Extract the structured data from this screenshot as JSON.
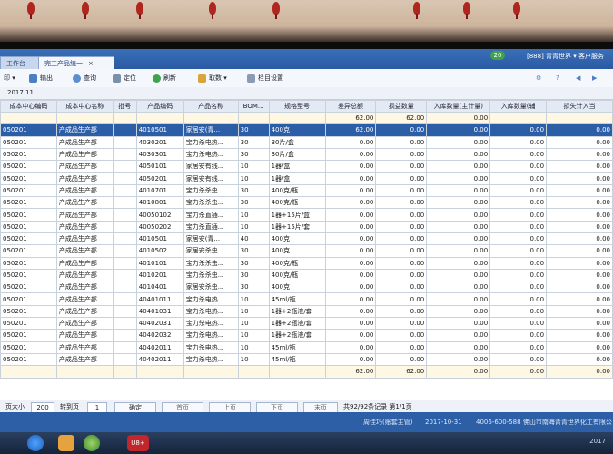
{
  "window": {
    "tab_inactive": "工作台",
    "tab_active": "完工产品统一",
    "top_right": "[888] 青青世界 ▾  客户服务",
    "user_badge": "20"
  },
  "toolbar": {
    "output_label": "输出",
    "query_label": "查询",
    "locate_label": "定位",
    "refresh_label": "刷新",
    "fetch_label": "取数",
    "column_settings_label": "栏目设置"
  },
  "period": "2017.11",
  "columns": [
    "成本中心编码",
    "成本中心名称",
    "批号",
    "产品编码",
    "产品名称",
    "BOM...",
    "规格型号",
    "差异总额",
    "损益数量",
    "入库数量(主计量)",
    "入库数量(辅",
    "损失计入当"
  ],
  "summary_row": [
    "",
    "",
    "",
    "",
    "",
    "",
    "",
    "62.00",
    "62.00",
    "0.00",
    "",
    ""
  ],
  "rows": [
    [
      "050201",
      "产成品生产部",
      "",
      "4010501",
      "家居安(青...",
      "30",
      "400克",
      "62.00",
      "0.00",
      "0.00",
      "0.00",
      "0.00"
    ],
    [
      "050201",
      "产成品生产部",
      "",
      "4030201",
      "宝力杀电热...",
      "30",
      "30片/盒",
      "0.00",
      "0.00",
      "0.00",
      "0.00",
      "0.00"
    ],
    [
      "050201",
      "产成品生产部",
      "",
      "4030301",
      "宝力杀电热...",
      "30",
      "30片/盒",
      "0.00",
      "0.00",
      "0.00",
      "0.00",
      "0.00"
    ],
    [
      "050201",
      "产成品生产部",
      "",
      "4050101",
      "家居安有线...",
      "10",
      "1器/盒",
      "0.00",
      "0.00",
      "0.00",
      "0.00",
      "0.00"
    ],
    [
      "050201",
      "产成品生产部",
      "",
      "4050201",
      "家居安有线...",
      "10",
      "1器/盒",
      "0.00",
      "0.00",
      "0.00",
      "0.00",
      "0.00"
    ],
    [
      "050201",
      "产成品生产部",
      "",
      "4010701",
      "宝力杀杀虫...",
      "30",
      "400克/瓶",
      "0.00",
      "0.00",
      "0.00",
      "0.00",
      "0.00"
    ],
    [
      "050201",
      "产成品生产部",
      "",
      "4010801",
      "宝力杀杀虫...",
      "30",
      "400克/瓶",
      "0.00",
      "0.00",
      "0.00",
      "0.00",
      "0.00"
    ],
    [
      "050201",
      "产成品生产部",
      "",
      "40050102",
      "宝力杀直插...",
      "10",
      "1器+15片/盒",
      "0.00",
      "0.00",
      "0.00",
      "0.00",
      "0.00"
    ],
    [
      "050201",
      "产成品生产部",
      "",
      "40050202",
      "宝力杀直插...",
      "10",
      "1器+15片/套",
      "0.00",
      "0.00",
      "0.00",
      "0.00",
      "0.00"
    ],
    [
      "050201",
      "产成品生产部",
      "",
      "4010501",
      "家居安(青...",
      "40",
      "400克",
      "0.00",
      "0.00",
      "0.00",
      "0.00",
      "0.00"
    ],
    [
      "050201",
      "产成品生产部",
      "",
      "4010502",
      "家居安杀虫...",
      "30",
      "400克",
      "0.00",
      "0.00",
      "0.00",
      "0.00",
      "0.00"
    ],
    [
      "050201",
      "产成品生产部",
      "",
      "4010101",
      "宝力杀杀虫...",
      "30",
      "400克/瓶",
      "0.00",
      "0.00",
      "0.00",
      "0.00",
      "0.00"
    ],
    [
      "050201",
      "产成品生产部",
      "",
      "4010201",
      "宝力杀杀虫...",
      "30",
      "400克/瓶",
      "0.00",
      "0.00",
      "0.00",
      "0.00",
      "0.00"
    ],
    [
      "050201",
      "产成品生产部",
      "",
      "4010401",
      "家居安杀虫...",
      "30",
      "400克",
      "0.00",
      "0.00",
      "0.00",
      "0.00",
      "0.00"
    ],
    [
      "050201",
      "产成品生产部",
      "",
      "40401011",
      "宝力杀电热...",
      "10",
      "45ml/瓶",
      "0.00",
      "0.00",
      "0.00",
      "0.00",
      "0.00"
    ],
    [
      "050201",
      "产成品生产部",
      "",
      "40401031",
      "宝力杀电热...",
      "10",
      "1器+2瓶液/套",
      "0.00",
      "0.00",
      "0.00",
      "0.00",
      "0.00"
    ],
    [
      "050201",
      "产成品生产部",
      "",
      "40402031",
      "宝力杀电热...",
      "10",
      "1器+2瓶液/套",
      "0.00",
      "0.00",
      "0.00",
      "0.00",
      "0.00"
    ],
    [
      "050201",
      "产成品生产部",
      "",
      "40402032",
      "宝力杀电热...",
      "10",
      "1器+2瓶液/套",
      "0.00",
      "0.00",
      "0.00",
      "0.00",
      "0.00"
    ],
    [
      "050201",
      "产成品生产部",
      "",
      "40402011",
      "宝力杀电热...",
      "10",
      "45ml/瓶",
      "0.00",
      "0.00",
      "0.00",
      "0.00",
      "0.00"
    ],
    [
      "050201",
      "产成品生产部",
      "",
      "40402011",
      "宝力杀电热...",
      "10",
      "45ml/瓶",
      "0.00",
      "0.00",
      "0.00",
      "0.00",
      "0.00"
    ]
  ],
  "total_row": [
    "",
    "",
    "",
    "",
    "",
    "",
    "",
    "62.00",
    "62.00",
    "0.00",
    "0.00",
    "0.00"
  ],
  "pager": {
    "page_size_label": "页大小",
    "page_size": "200",
    "goto_label": "转到页",
    "goto_value": "1",
    "confirm": "确定",
    "first": "首页",
    "prev": "上页",
    "next": "下页",
    "last": "末页",
    "summary": "共92/92条记录 第1/1页"
  },
  "statusbar": {
    "user": "周佳巧(账套主管)",
    "date": "2017-10-31",
    "phone": "4006-600-588 佛山市南海青青世界化工有限公司"
  },
  "colors": {
    "accent": "#2c5ea8",
    "header_bg": "#e3eaf3",
    "summary_bg": "#fdf7e3",
    "statusbar": "#2c5fa6"
  },
  "taskbar": {
    "app_label": "U8+",
    "clock": "2017"
  }
}
